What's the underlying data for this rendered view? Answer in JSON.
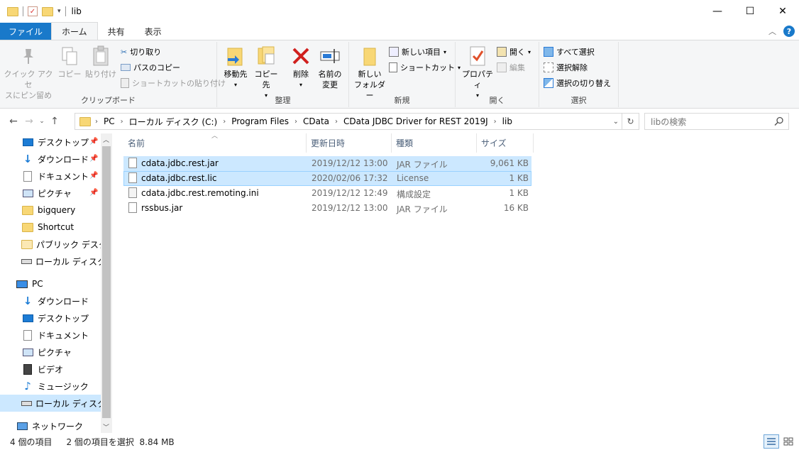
{
  "window": {
    "title": "lib",
    "controls": {
      "minimize": "—",
      "maximize": "☐",
      "close": "✕"
    }
  },
  "tabs": [
    {
      "label": "ファイル"
    },
    {
      "label": "ホーム"
    },
    {
      "label": "共有"
    },
    {
      "label": "表示"
    }
  ],
  "ribbon": {
    "clipboard": {
      "label": "クリップボード",
      "pin": "クイック アクセス\nにピン留め",
      "pin_line1": "クイック アクセ",
      "pin_line2": "スにピン留め",
      "copy": "コピー",
      "paste": "貼り付け",
      "cut": "切り取り",
      "copy_path": "パスのコピー",
      "paste_shortcut": "ショートカットの貼り付け"
    },
    "organize": {
      "label": "整理",
      "move_to": "移動先",
      "copy_to": "コピー先",
      "delete": "削除",
      "rename_line1": "名前の",
      "rename_line2": "変更"
    },
    "new": {
      "label": "新規",
      "new_folder_line1": "新しい",
      "new_folder_line2": "フォルダー",
      "new_item": "新しい項目",
      "shortcut": "ショートカット"
    },
    "open": {
      "label": "開く",
      "properties": "プロパティ",
      "open": "開く",
      "edit": "編集"
    },
    "select": {
      "label": "選択",
      "select_all": "すべて選択",
      "select_none": "選択解除",
      "invert": "選択の切り替え"
    }
  },
  "address": {
    "crumbs": [
      "PC",
      "ローカル ディスク (C:)",
      "Program Files",
      "CData",
      "CData JDBC Driver for REST 2019J",
      "lib"
    ],
    "search_placeholder": "libの検索"
  },
  "nav_pane": {
    "quick_access": [
      {
        "label": "デスクトップ",
        "pinned": true
      },
      {
        "label": "ダウンロード",
        "pinned": true
      },
      {
        "label": "ドキュメント",
        "pinned": true
      },
      {
        "label": "ピクチャ",
        "pinned": true
      },
      {
        "label": "bigquery",
        "pinned": false
      },
      {
        "label": "Shortcut",
        "pinned": false
      },
      {
        "label": "パブリック デスクトップ",
        "pinned": false
      },
      {
        "label": "ローカル ディスク (C:)",
        "pinned": false
      }
    ],
    "pc_label": "PC",
    "pc_items": [
      {
        "label": "ダウンロード"
      },
      {
        "label": "デスクトップ"
      },
      {
        "label": "ドキュメント"
      },
      {
        "label": "ピクチャ"
      },
      {
        "label": "ビデオ"
      },
      {
        "label": "ミュージック"
      },
      {
        "label": "ローカル ディスク (C:)"
      }
    ],
    "network_label": "ネットワーク"
  },
  "columns": {
    "name": "名前",
    "modified": "更新日時",
    "type": "種類",
    "size": "サイズ"
  },
  "files": [
    {
      "name": "cdata.jdbc.rest.jar",
      "modified": "2019/12/12 13:00",
      "type": "JAR ファイル",
      "size": "9,061 KB",
      "selected": true
    },
    {
      "name": "cdata.jdbc.rest.lic",
      "modified": "2020/02/06 17:32",
      "type": "License",
      "size": "1 KB",
      "selected": true
    },
    {
      "name": "cdata.jdbc.rest.remoting.ini",
      "modified": "2019/12/12 12:49",
      "type": "構成設定",
      "size": "1 KB",
      "selected": false
    },
    {
      "name": "rssbus.jar",
      "modified": "2019/12/12 13:00",
      "type": "JAR ファイル",
      "size": "16 KB",
      "selected": false
    }
  ],
  "status": {
    "item_count": "4 個の項目",
    "selection": "2 個の項目を選択  8.84 MB"
  },
  "colors": {
    "accent": "#1979ca",
    "selection": "#cce8ff",
    "folder": "#f8d775"
  }
}
